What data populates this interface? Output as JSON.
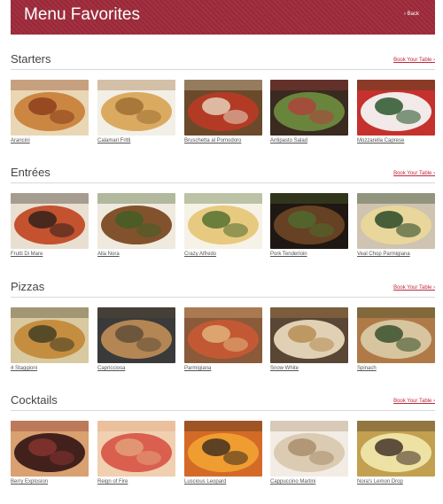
{
  "header": {
    "title": "Menu Favorites",
    "back_label": "‹ Back"
  },
  "book_label": "Book Your Table ›",
  "sections": [
    {
      "title": "Starters",
      "items": [
        {
          "name": "Arancini",
          "colors": [
            "#c9823c",
            "#8a3b1a",
            "#e9d6b5"
          ]
        },
        {
          "name": "Calamari Fritti",
          "colors": [
            "#d9a55a",
            "#9b6b32",
            "#f2efe6"
          ]
        },
        {
          "name": "Bruschetta al Pomodoro",
          "colors": [
            "#b73a26",
            "#e7d9c2",
            "#6a4a2a"
          ]
        },
        {
          "name": "Antipasto Salad",
          "colors": [
            "#6c8a3e",
            "#b2403b",
            "#3a2a1f"
          ]
        },
        {
          "name": "Mozzarella Caprese",
          "colors": [
            "#f4f4f2",
            "#1f4d20",
            "#c5312c"
          ]
        }
      ]
    },
    {
      "title": "Entrées",
      "items": [
        {
          "name": "Frutti Di Mare",
          "colors": [
            "#c24a26",
            "#2b1f1a",
            "#e9dfd0"
          ]
        },
        {
          "name": "Alla Nora",
          "colors": [
            "#7a4a22",
            "#3f5f26",
            "#efe9de"
          ]
        },
        {
          "name": "Crazy Alfredo",
          "colors": [
            "#e6c77a",
            "#4e6a2b",
            "#f7f2e6"
          ]
        },
        {
          "name": "Pork Tenderloin",
          "colors": [
            "#6a4324",
            "#4f6c2e",
            "#1f1713"
          ]
        },
        {
          "name": "Veal Chop Parmigiana",
          "colors": [
            "#e9d79a",
            "#1f4020",
            "#cfc3b1"
          ]
        }
      ]
    },
    {
      "title": "Pizzas",
      "items": [
        {
          "name": "4 Staggioni",
          "colors": [
            "#c38a3a",
            "#3c3a22",
            "#d9c9a0"
          ]
        },
        {
          "name": "Capricciosa",
          "colors": [
            "#b98a55",
            "#5d4a36",
            "#3a3a3a"
          ]
        },
        {
          "name": "Parmigiana",
          "colors": [
            "#c65a34",
            "#e3b77e",
            "#8a5a3a"
          ]
        },
        {
          "name": "Snow White",
          "colors": [
            "#e8d9bd",
            "#b5894f",
            "#5a4634"
          ]
        },
        {
          "name": "Spinach",
          "colors": [
            "#d9c9a4",
            "#2f4a25",
            "#b07a48"
          ]
        }
      ]
    },
    {
      "title": "Cocktails",
      "items": [
        {
          "name": "Berry Explosion",
          "colors": [
            "#3a1a18",
            "#8a3430",
            "#d9a070"
          ]
        },
        {
          "name": "Reign of Fire",
          "colors": [
            "#d8584a",
            "#e3a27a",
            "#f0d0b0"
          ]
        },
        {
          "name": "Luscious Leopard",
          "colors": [
            "#f0a030",
            "#3a2a1f",
            "#d46a28"
          ]
        },
        {
          "name": "Cappuccino Martini",
          "colors": [
            "#d9c9b0",
            "#a88a68",
            "#f2ece4"
          ]
        },
        {
          "name": "Nora's Lemon Drop",
          "colors": [
            "#efe6a8",
            "#3a2a22",
            "#c2a050"
          ]
        }
      ]
    }
  ]
}
